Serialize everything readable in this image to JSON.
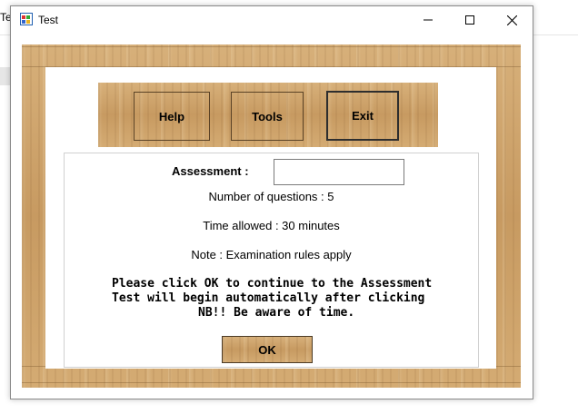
{
  "background": {
    "tab_text": "Tes"
  },
  "window": {
    "title": "Test",
    "controls": {
      "minimize": "minimize-icon",
      "maximize": "maximize-icon",
      "close": "close-icon"
    }
  },
  "toolbar": {
    "help_label": "Help",
    "tools_label": "Tools",
    "exit_label": "Exit"
  },
  "assessment": {
    "label": "Assessment :",
    "input_value": "",
    "questions_text": "Number of questions : 5",
    "time_text": "Time allowed : 30 minutes",
    "note_text": "Note : Examination rules apply",
    "message_line1": "Please click OK to continue to the Assessment",
    "message_line2": "Test will begin automatically after clicking",
    "message_line3": "NB!! Be aware of time.",
    "ok_label": "OK"
  },
  "colors": {
    "wood": "#c99d64",
    "panel": "#ffffff",
    "border_dark": "#2e2e2e"
  }
}
